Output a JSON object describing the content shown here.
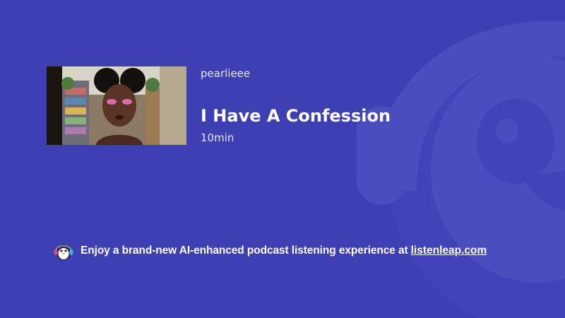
{
  "episode": {
    "author": "pearlieee",
    "title": "I Have A Confession",
    "duration": "10min",
    "thumbnail_icon": "video-thumbnail"
  },
  "promo": {
    "text": "Enjoy a brand-new AI-enhanced podcast listening experience at",
    "link_label": "listenleap.com",
    "logo_icon": "penguin-headphones-logo"
  },
  "colors": {
    "background": "#3e3fb3",
    "mascot_watermark": "#4a4dbd",
    "text": "#ffffff"
  }
}
